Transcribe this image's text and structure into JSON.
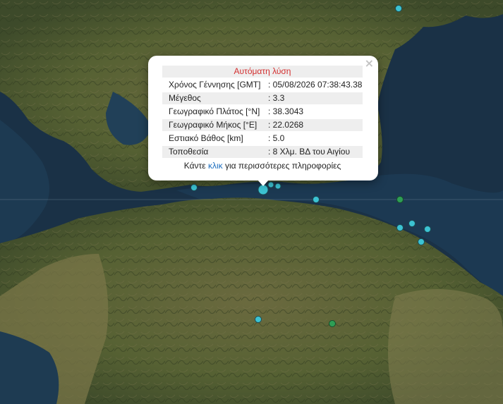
{
  "popup": {
    "title": "Αυτόματη λύση",
    "close_symbol": "×",
    "rows": [
      {
        "key": "Χρόνος Γέννησης [GMT]",
        "value": ": 05/08/2026 07:38:43.38"
      },
      {
        "key": "Μέγεθος",
        "value": ": 3.3"
      },
      {
        "key": "Γεωγραφικό Πλάτος [°N]",
        "value": ": 38.3043"
      },
      {
        "key": "Γεωγραφικό Μήκος [°E]",
        "value": ": 22.0268"
      },
      {
        "key": "Εστιακό Βάθος [km]",
        "value": ": 5.0"
      },
      {
        "key": "Τοποθεσία",
        "value": ": 8 Χλμ. ΒΔ του Αιγίου"
      }
    ],
    "footer_prefix": "Κάντε ",
    "footer_link": "κλικ",
    "footer_suffix": " για περισσότερες πληροφορίες"
  },
  "colors": {
    "marker_cyan": "#3cc3d3",
    "marker_green": "#2e9e55",
    "title_red": "#d32f2f",
    "link_blue": "#1e6fbf"
  }
}
